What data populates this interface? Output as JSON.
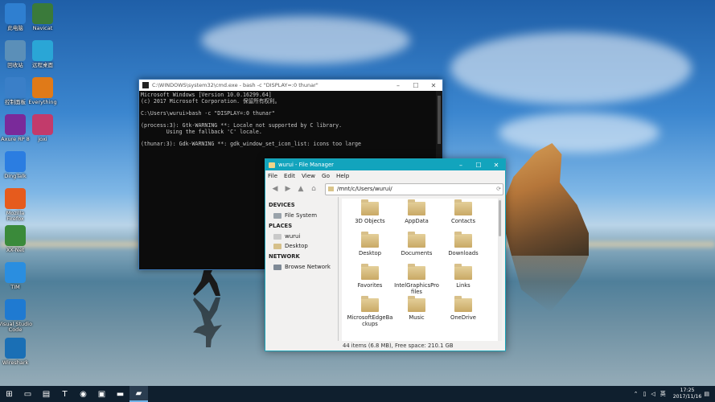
{
  "desktop_icons": [
    {
      "label": "此电脑",
      "icon": "computer-icon",
      "color": "#2f7fd0"
    },
    {
      "label": "Navicat",
      "icon": "navicat-icon",
      "color": "#3a7a3a"
    },
    {
      "label": "回收站",
      "icon": "recycle-bin-icon",
      "color": "#5b8fb8"
    },
    {
      "label": "远程桌面",
      "icon": "remote-desktop-icon",
      "color": "#2aa6d6"
    },
    {
      "label": "控制面板",
      "icon": "control-panel-icon",
      "color": "#3a7fc8"
    },
    {
      "label": "Everything",
      "icon": "search-everything-icon",
      "color": "#e07a18"
    },
    {
      "label": "Axure RP 8",
      "icon": "axure-icon",
      "color": "#7a2a9a"
    },
    {
      "label": "joxi",
      "icon": "joxi-icon",
      "color": "#c23b6b"
    },
    {
      "label": "DingTalk",
      "icon": "dingtalk-icon",
      "color": "#2b7de1"
    },
    {
      "label": "Mozilla Firefox",
      "icon": "firefox-icon",
      "color": "#e65b1d"
    },
    {
      "label": "XX-Net",
      "icon": "xxnet-icon",
      "color": "#3a8a3a"
    },
    {
      "label": "TIM",
      "icon": "tim-icon",
      "color": "#2a8ee0"
    },
    {
      "label": "Visual Studio Code",
      "icon": "vscode-icon",
      "color": "#1f7ad1"
    },
    {
      "label": "Wireshark",
      "icon": "wireshark-icon",
      "color": "#1a6fb5"
    }
  ],
  "cmd": {
    "title": "C:\\WINDOWS\\system32\\cmd.exe - bash -c \"DISPLAY=:0 thunar\"",
    "lines": [
      "Microsoft Windows [Version 10.0.16299.64]",
      "(c) 2017 Microsoft Corporation. 保留所有权利。",
      "",
      "C:\\Users\\wurui>bash -c \"DISPLAY=:0 thunar\"",
      "",
      "(process:3): Gtk-WARNING **: Locale not supported by C library.",
      "        Using the fallback 'C' locale.",
      "",
      "(thunar:3): Gdk-WARNING **: gdk_window_set_icon_list: icons too large"
    ]
  },
  "file_manager": {
    "title": "wurui - File Manager",
    "menu": [
      "File",
      "Edit",
      "View",
      "Go",
      "Help"
    ],
    "path": "/mnt/c/Users/wurui/",
    "sidebar": {
      "devices_header": "DEVICES",
      "devices": [
        {
          "label": "File System",
          "icon": "drive-icon"
        }
      ],
      "places_header": "PLACES",
      "places": [
        {
          "label": "wurui",
          "icon": "home-folder-icon"
        },
        {
          "label": "Desktop",
          "icon": "desktop-folder-icon"
        }
      ],
      "network_header": "NETWORK",
      "network": [
        {
          "label": "Browse Network",
          "icon": "network-icon"
        }
      ]
    },
    "files": [
      "3D Objects",
      "AppData",
      "Contacts",
      "Desktop",
      "Documents",
      "Downloads",
      "Favorites",
      "IntelGraphicsProfiles",
      "Links",
      "MicrosoftEdgeBackups",
      "Music",
      "OneDrive"
    ],
    "status": "44 items (6.8 MB), Free space: 210.1 GB"
  },
  "taskbar": {
    "items": [
      {
        "icon": "start-windows-icon",
        "glyph": "⊞"
      },
      {
        "icon": "task-view-icon",
        "glyph": "▭"
      },
      {
        "icon": "file-explorer-icon",
        "glyph": "▤"
      },
      {
        "icon": "typora-icon",
        "glyph": "T"
      },
      {
        "icon": "firefox-icon",
        "glyph": "◉"
      },
      {
        "icon": "store-icon",
        "glyph": "▣"
      },
      {
        "icon": "terminal-icon",
        "glyph": "▬"
      },
      {
        "icon": "thunar-folder-icon",
        "glyph": "▰"
      }
    ],
    "time": "17:25",
    "date": "2017/11/16"
  }
}
